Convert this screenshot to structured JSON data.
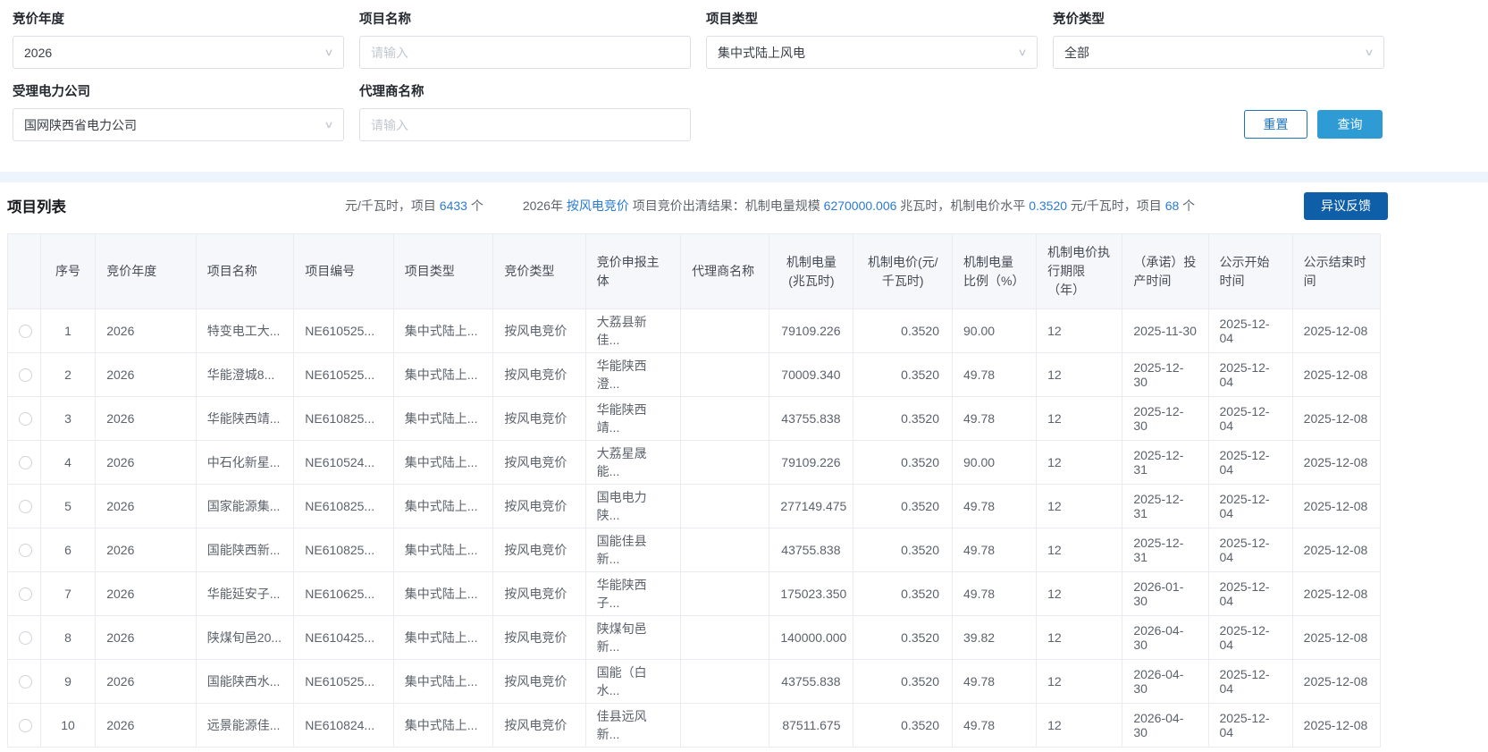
{
  "filters": {
    "fields": [
      {
        "label": "竞价年度",
        "type": "select",
        "value": "2026"
      },
      {
        "label": "项目名称",
        "type": "input",
        "placeholder": "请输入"
      },
      {
        "label": "项目类型",
        "type": "select",
        "value": "集中式陆上风电"
      },
      {
        "label": "竞价类型",
        "type": "select",
        "value": "全部"
      },
      {
        "label": "受理电力公司",
        "type": "select",
        "value": "国网陕西省电力公司"
      },
      {
        "label": "代理商名称",
        "type": "input",
        "placeholder": "请输入"
      }
    ],
    "reset_label": "重置",
    "query_label": "查询"
  },
  "list_header": {
    "title": "项目列表",
    "stats_left": {
      "text": "元/千瓦时，项目 ",
      "count": "6433",
      "unit": " 个"
    },
    "stats_right": {
      "s1": "2026年 ",
      "link": "按风电竞价",
      "s2": " 项目竞价出清结果：机制电量规模 ",
      "v1": "6270000.006",
      "s3": " 兆瓦时，机制电价水平 ",
      "v2": "0.3520",
      "s4": " 元/千瓦时，项目 ",
      "v3": "68",
      "s5": " 个"
    },
    "feedback_label": "异议反馈"
  },
  "table": {
    "columns": [
      "",
      "序号",
      "竞价年度",
      "项目名称",
      "项目编号",
      "项目类型",
      "竞价类型",
      "竞价申报主体",
      "代理商名称",
      "机制电量(兆瓦时)",
      "机制电价(元/千瓦时)",
      "机制电量比例（%）",
      "机制电价执行期限（年）",
      "（承诺）投产时间",
      "公示开始时间",
      "公示结束时间"
    ],
    "rows": [
      {
        "cells": [
          "1",
          "2026",
          "特变电工大...",
          "NE610525...",
          "集中式陆上...",
          "按风电竞价",
          "大荔县新佳...",
          "",
          "79109.226",
          "0.3520",
          "90.00",
          "12",
          "2025-11-30",
          "2025-12-04",
          "2025-12-08"
        ]
      },
      {
        "cells": [
          "2",
          "2026",
          "华能澄城8...",
          "NE610525...",
          "集中式陆上...",
          "按风电竞价",
          "华能陕西澄...",
          "",
          "70009.340",
          "0.3520",
          "49.78",
          "12",
          "2025-12-30",
          "2025-12-04",
          "2025-12-08"
        ]
      },
      {
        "cells": [
          "3",
          "2026",
          "华能陕西靖...",
          "NE610825...",
          "集中式陆上...",
          "按风电竞价",
          "华能陕西靖...",
          "",
          "43755.838",
          "0.3520",
          "49.78",
          "12",
          "2025-12-30",
          "2025-12-04",
          "2025-12-08"
        ]
      },
      {
        "cells": [
          "4",
          "2026",
          "中石化新星...",
          "NE610524...",
          "集中式陆上...",
          "按风电竞价",
          "大荔星晟能...",
          "",
          "79109.226",
          "0.3520",
          "90.00",
          "12",
          "2025-12-31",
          "2025-12-04",
          "2025-12-08"
        ]
      },
      {
        "cells": [
          "5",
          "2026",
          "国家能源集...",
          "NE610825...",
          "集中式陆上...",
          "按风电竞价",
          "国电电力陕...",
          "",
          "277149.475",
          "0.3520",
          "49.78",
          "12",
          "2025-12-31",
          "2025-12-04",
          "2025-12-08"
        ]
      },
      {
        "cells": [
          "6",
          "2026",
          "国能陕西新...",
          "NE610825...",
          "集中式陆上...",
          "按风电竞价",
          "国能佳县新...",
          "",
          "43755.838",
          "0.3520",
          "49.78",
          "12",
          "2025-12-31",
          "2025-12-04",
          "2025-12-08"
        ]
      },
      {
        "cells": [
          "7",
          "2026",
          "华能延安子...",
          "NE610625...",
          "集中式陆上...",
          "按风电竞价",
          "华能陕西子...",
          "",
          "175023.350",
          "0.3520",
          "49.78",
          "12",
          "2026-01-30",
          "2025-12-04",
          "2025-12-08"
        ]
      },
      {
        "cells": [
          "8",
          "2026",
          "陕煤旬邑20...",
          "NE610425...",
          "集中式陆上...",
          "按风电竞价",
          "陕煤旬邑新...",
          "",
          "140000.000",
          "0.3520",
          "39.82",
          "12",
          "2026-04-30",
          "2025-12-04",
          "2025-12-08"
        ]
      },
      {
        "cells": [
          "9",
          "2026",
          "国能陕西水...",
          "NE610525...",
          "集中式陆上...",
          "按风电竞价",
          "国能（白水...",
          "",
          "43755.838",
          "0.3520",
          "49.78",
          "12",
          "2026-04-30",
          "2025-12-04",
          "2025-12-08"
        ]
      },
      {
        "cells": [
          "10",
          "2026",
          "远景能源佳...",
          "NE610824...",
          "集中式陆上...",
          "按风电竞价",
          "佳县远风新...",
          "",
          "87511.675",
          "0.3520",
          "49.78",
          "12",
          "2026-04-30",
          "2025-12-04",
          "2025-12-08"
        ]
      }
    ]
  },
  "colors": {
    "query_button": "#2e9bd5",
    "reset_button_border": "#1b72bd",
    "feedback_button": "#0f5fa8",
    "link_blue": "#2a7bd0",
    "divider_band": "#edf4fb",
    "table_header_bg": "#f6f7fb"
  }
}
